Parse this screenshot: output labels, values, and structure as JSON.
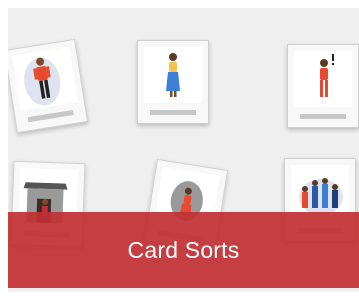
{
  "banner": {
    "title": "Card Sorts"
  },
  "colors": {
    "banner": "#c12f32",
    "background": "#efefef",
    "card": "#f8f8f8"
  },
  "cards": [
    {
      "icon": "man-standing-icon"
    },
    {
      "icon": "woman-standing-icon"
    },
    {
      "icon": "woman-exclaiming-icon"
    },
    {
      "icon": "house-person-icon"
    },
    {
      "icon": "woman-in-circle-icon"
    },
    {
      "icon": "family-group-icon"
    }
  ]
}
